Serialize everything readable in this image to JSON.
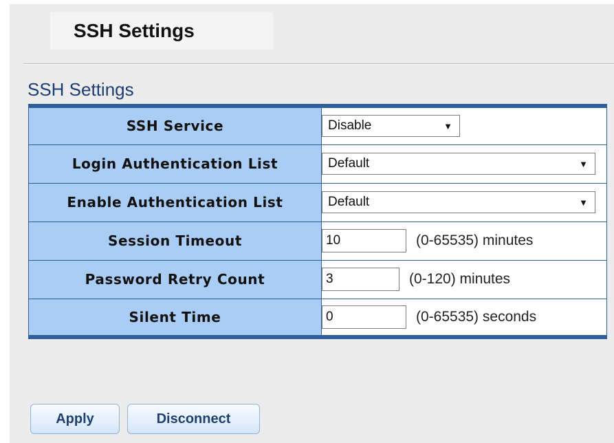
{
  "page": {
    "tab_title": "SSH Settings",
    "section_title": "SSH Settings"
  },
  "rows": [
    {
      "label": "SSH Service",
      "type": "select",
      "value": "Disable"
    },
    {
      "label": "Login Authentication List",
      "type": "select",
      "value": "Default"
    },
    {
      "label": "Enable Authentication List",
      "type": "select",
      "value": "Default"
    },
    {
      "label": "Session Timeout",
      "type": "text",
      "value": "10",
      "hint": "(0-65535) minutes"
    },
    {
      "label": "Password Retry Count",
      "type": "text",
      "value": "3",
      "hint": "(0-120) minutes"
    },
    {
      "label": "Silent Time",
      "type": "text",
      "value": "0",
      "hint": "(0-65535) seconds"
    }
  ],
  "buttons": {
    "apply": "Apply",
    "disconnect": "Disconnect"
  },
  "icons": {
    "dropdown": "caret-down-icon"
  },
  "colors": {
    "label_bg": "#a9cdf4",
    "table_border": "#2f5f9a",
    "section_title": "#1b3e72",
    "button_text": "#1e3f70"
  }
}
